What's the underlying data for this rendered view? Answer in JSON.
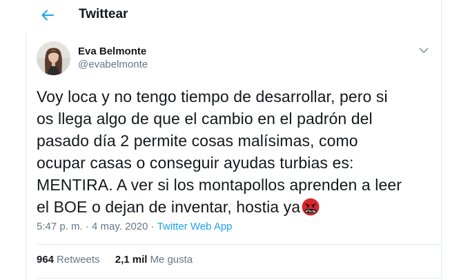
{
  "header": {
    "title": "Twittear",
    "back_icon": "arrow-left-icon",
    "accent_color": "#1da1f2"
  },
  "tweet": {
    "author": {
      "name": "Eva Belmonte",
      "handle": "@evabelmonte",
      "avatar_icon": "profile-photo"
    },
    "menu_icon": "chevron-down-icon",
    "text_lines": [
      "Voy loca y no tengo tiempo de desarrollar, pero si",
      "os llega algo de que el cambio en el padrón del",
      "pasado día 2 permite cosas malísimas, como",
      "ocupar casas o conseguir ayudas turbias es:",
      "MENTIRA. A ver si los montapollos aprenden a leer",
      "el BOE o dejan de inventar, hostia ya"
    ],
    "emoji": "face-with-symbols-on-mouth",
    "meta": {
      "time": "5:47 p. m.",
      "separator": "·",
      "date": "4 may. 2020",
      "source": "Twitter Web App"
    },
    "stats": {
      "retweets_count": "964",
      "retweets_label": "Retweets",
      "likes_count": "2,1 mil",
      "likes_label": "Me gusta"
    }
  },
  "colors": {
    "text": "#14171a",
    "secondary": "#657786",
    "link": "#1da1f2",
    "border": "#e6ecf0"
  }
}
